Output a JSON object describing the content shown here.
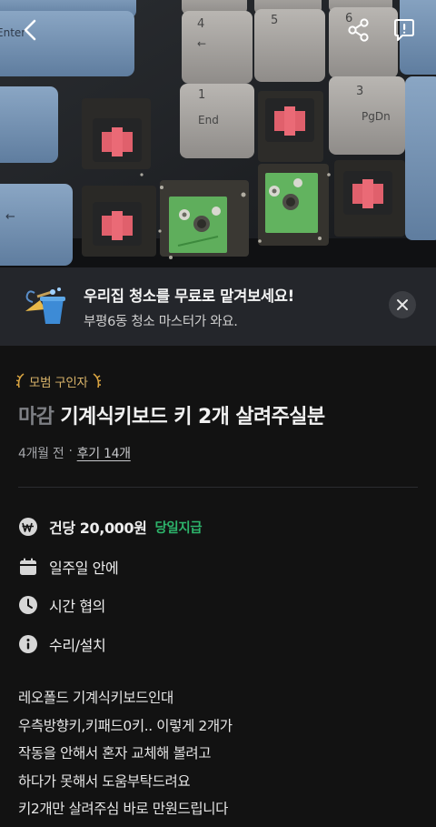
{
  "nav": {
    "back_icon": "chevron-left-icon",
    "share_icon": "share-icon",
    "report_icon": "report-bubble-icon"
  },
  "photo": {
    "key_labels": [
      "4",
      "5",
      "6",
      "1",
      "End",
      "3",
      "PgDn",
      "Enter"
    ],
    "key_arrow_glyph": "←"
  },
  "promo": {
    "icon": "cleaning-bucket-icon",
    "title": "우리집 청소를 무료로 맡겨보세요!",
    "subtitle": "부평6동 청소 마스터가 와요.",
    "close_icon": "close-icon"
  },
  "post": {
    "badge": "모범 구인자",
    "status": "마감",
    "title": "기계식키보드 키 2개 살려주실분",
    "time_ago": "4개월 전",
    "separator": "·",
    "reviews": "후기 14개",
    "info": {
      "pay": {
        "icon": "won-icon",
        "amount": "건당 20,000원",
        "tag": "당일지급"
      },
      "schedule": {
        "icon": "calendar-icon",
        "text": "일주일 안에"
      },
      "time": {
        "icon": "clock-icon",
        "text": "시간 협의"
      },
      "category": {
        "icon": "info-icon",
        "text": "수리/설치"
      }
    },
    "description": [
      "레오폴드 기계식키보드인대",
      "우측방향키,키패드0키.. 이렇게 2개가",
      "작동을 안해서 혼자 교체해 볼려고",
      "하다가 못해서 도움부탁드려요",
      "키2개만 살려주심 바로 만원드립니다"
    ]
  },
  "colors": {
    "background": "#121212",
    "banner": "#24262b",
    "badge": "#d9a441",
    "pay_tag": "#2db46b",
    "muted": "#7d7f84"
  }
}
